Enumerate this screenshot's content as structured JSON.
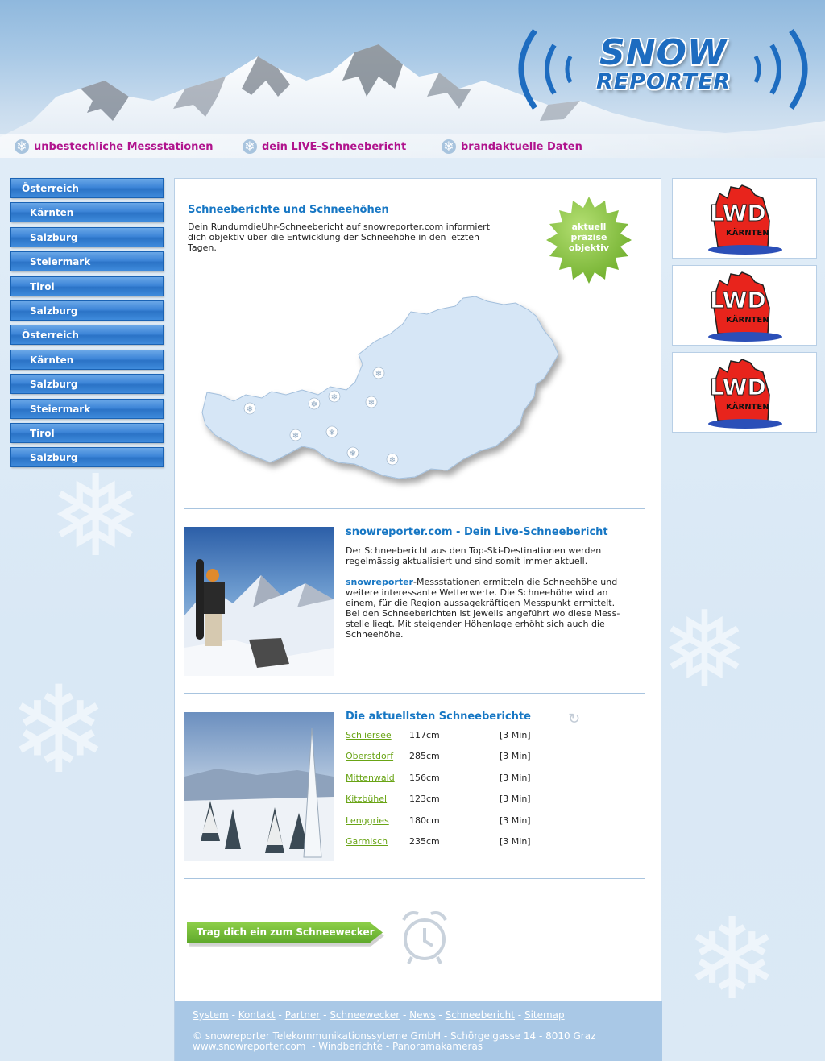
{
  "header": {
    "logo_word1": "SNOW",
    "logo_word2": "REPORTER",
    "taglines": [
      "unbestechliche Messstationen",
      "dein LIVE-Schneebericht",
      "brandaktuelle Daten"
    ]
  },
  "nav": {
    "items": [
      {
        "label": "Österreich",
        "level": "top"
      },
      {
        "label": "Kärnten",
        "level": "sub"
      },
      {
        "label": "Salzburg",
        "level": "sub"
      },
      {
        "label": "Steiermark",
        "level": "sub"
      },
      {
        "label": "Tirol",
        "level": "sub"
      },
      {
        "label": "Salzburg",
        "level": "sub"
      },
      {
        "label": "Österreich",
        "level": "top"
      },
      {
        "label": "Kärnten",
        "level": "sub"
      },
      {
        "label": "Salzburg",
        "level": "sub"
      },
      {
        "label": "Steiermark",
        "level": "sub"
      },
      {
        "label": "Tirol",
        "level": "sub"
      },
      {
        "label": "Salzburg",
        "level": "sub"
      }
    ]
  },
  "section1": {
    "title": "Schneeberichte und Schneehöhen",
    "text": "Dein RundumdieUhr-Schneebericht auf snowreporter.com informiert dich objektiv über die Entwicklung der Schneehöhe in den letzten Tagen.",
    "badge": [
      "aktuell",
      "präzise",
      "objektiv"
    ]
  },
  "section2": {
    "title": "snowreporter.com - Dein Live-Schneebericht",
    "p1": "Der Schneebericht aus den Top-Ski-Destinationen werden regelmässig aktualisiert und sind somit immer aktuell.",
    "p2_brand": "snowreporter",
    "p2_rest": "-Messstationen ermitteln die Schneehöhe und weitere interessante Wetterwerte. Die Schneehöhe wird an einem, für die Region aussagekräftigen Messpunkt ermittelt. Bei den Schneeberichten ist jeweils angeführt wo diese Mess-stelle liegt. Mit steigender Höhenlage erhöht sich auch die Schneehöhe."
  },
  "section3": {
    "title": "Die aktuellsten Schneeberichte",
    "reports": [
      {
        "place": "Schliersee",
        "depth": "117cm",
        "age": "[3 Min]"
      },
      {
        "place": "Oberstdorf",
        "depth": "285cm",
        "age": "[3 Min]"
      },
      {
        "place": "Mittenwald",
        "depth": "156cm",
        "age": "[3 Min]"
      },
      {
        "place": "Kitzbühel",
        "depth": "123cm",
        "age": "[3 Min]"
      },
      {
        "place": "Lenggries",
        "depth": "180cm",
        "age": "[3 Min]"
      },
      {
        "place": "Garmisch",
        "depth": "235cm",
        "age": "[3 Min]"
      }
    ]
  },
  "cta": {
    "label": "Trag dich ein zum Schneewecker"
  },
  "footer": {
    "links1": [
      "System",
      "Kontakt",
      "Partner",
      "Schneewecker",
      "News",
      "Schneebericht",
      "Sitemap"
    ],
    "copyright": "© snowreporter Telekommunikationssyteme GmbH - Schörgelgasse 14 - 8010 Graz",
    "links2": [
      "www.snowreporter.com",
      "Windberichte",
      "Panoramakameras"
    ]
  },
  "ads": {
    "text_top": "LWD",
    "text_bottom": "KÄRNTEN"
  },
  "colors": {
    "accent": "#1777c4",
    "tagline": "#b0138d",
    "link_green": "#69a415",
    "nav_blue": "#3d85d8"
  }
}
